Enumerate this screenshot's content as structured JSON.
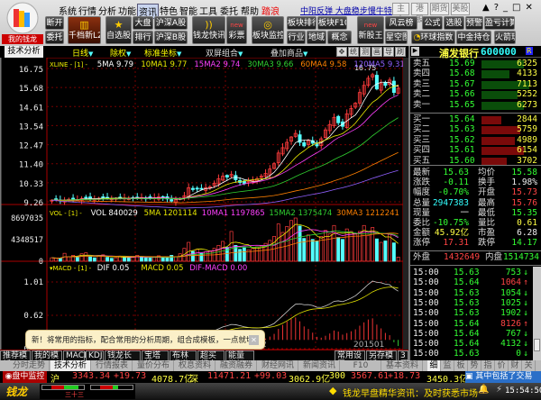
{
  "app": {
    "logo_label": "我的钱龙"
  },
  "menu": [
    "系统",
    "行情",
    "分析",
    "功能",
    "资讯",
    "特色",
    "智能",
    "工具",
    "委托",
    "帮助"
  ],
  "menu_promo": "踏浪",
  "headline": "中阳反弹 大盘稳步慢牛特征",
  "market_tabs": [
    "主力",
    "港股",
    "期货",
    "美股"
  ],
  "window_controls": [
    "▲",
    "?",
    "_",
    "□",
    "✕"
  ],
  "toolbar": {
    "disconnect": "断开",
    "trade": "委托",
    "l2": "千档新L2",
    "watchlist": "自选股",
    "dapan": "大盘",
    "rank": "排行",
    "hs_a": "沪深A股",
    "hs_b": "沪深B股",
    "news": "钱龙快讯",
    "lottery": "彩票",
    "lottery_badge": "new",
    "block_monitor": "板块监控",
    "block_rank": "板块排行",
    "block_f10": "板块F10",
    "industry": "行业",
    "region": "地域",
    "concept": "概念",
    "ipo": "新股王",
    "ipo_badge": "new",
    "fengyun": "风云榜",
    "starmap": "星空图",
    "formula": "公式",
    "pick": "选股",
    "alert": "预警",
    "pl": "盈亏计算",
    "global": "环球指数",
    "cicc": "中金持仓",
    "rocket": "火箭玩"
  },
  "analysis_bar": {
    "tab": "技术分析",
    "period": "日线",
    "rights": "除权",
    "coord": "标准坐标",
    "dual": "双屏组合",
    "overlay": "叠加商品",
    "tools": [
      "✥",
      "统",
      "测",
      "画",
      "导",
      "刷"
    ]
  },
  "stock": {
    "name": "浦发银行",
    "code": "600000",
    "badge": "R"
  },
  "price_panel": {
    "legend_name": "XLINE - [1] -",
    "legend": [
      {
        "t": "5MA 9.79",
        "c": "#ffffff"
      },
      {
        "t": "10MA1 9.77",
        "c": "#e8e800"
      },
      {
        "t": "15MA2 9.74",
        "c": "#ff40ff"
      },
      {
        "t": "30MA3 9.66",
        "c": "#30d030"
      },
      {
        "t": "60MA4 9.58",
        "c": "#ff8000"
      },
      {
        "t": "120MA5 9.31",
        "c": "#9060ff"
      }
    ],
    "axis": [
      "16.75",
      "15.68",
      "14.61",
      "13.54",
      "12.47",
      "11.40",
      "10.33",
      "9.26"
    ],
    "high_label": "16.75"
  },
  "volume_panel": {
    "legend_name": "VOL - [1] -",
    "legend": [
      {
        "t": "VOL 840029",
        "c": "#ffffff"
      },
      {
        "t": "5MA 1201114",
        "c": "#e8e800"
      },
      {
        "t": "10MA1 1197865",
        "c": "#ff40ff"
      },
      {
        "t": "15MA2 1375474",
        "c": "#30d030"
      },
      {
        "t": "30MA3 1212241",
        "c": "#ff8000"
      }
    ],
    "axis": [
      "8697035",
      "4348517",
      "0"
    ]
  },
  "macd_panel": {
    "legend_name": "▾MACD - [1] -",
    "legend": [
      {
        "t": "DIF 0.05",
        "c": "#ffffff"
      },
      {
        "t": "MACD 0.05",
        "c": "#e8e800"
      },
      {
        "t": "DIF-MACD 0.00",
        "c": "#ff40ff"
      }
    ],
    "axis": [
      "1.01",
      "0.62",
      "0.23"
    ],
    "date_labels": [
      "2",
      "201501"
    ]
  },
  "chart_data": {
    "type": "candlestick",
    "closes": [
      9.35,
      9.38,
      9.32,
      9.36,
      9.4,
      9.42,
      9.38,
      9.45,
      9.5,
      9.44,
      9.4,
      9.46,
      9.52,
      9.48,
      9.42,
      9.45,
      9.5,
      9.47,
      9.43,
      9.48,
      9.52,
      9.5,
      9.46,
      9.44,
      9.49,
      9.53,
      9.47,
      9.42,
      9.3,
      9.38,
      9.45,
      9.6,
      10.05,
      9.95,
      10.0,
      9.98,
      10.05,
      10.1,
      10.3,
      10.55,
      10.7,
      10.65,
      10.8,
      10.5,
      10.35,
      10.3,
      10.4,
      10.45,
      10.55,
      10.7,
      10.85,
      11.1,
      11.4,
      12.0,
      12.3,
      12.6,
      12.9,
      13.1,
      12.6,
      12.4,
      12.7,
      12.55,
      12.4,
      12.8,
      13.3,
      13.6,
      14.0,
      13.7,
      13.5,
      14.2,
      14.5,
      14.8,
      15.4,
      15.8,
      16.2,
      16.4,
      15.6,
      15.9,
      15.8,
      16.1,
      15.4,
      15.63
    ],
    "volumes": [
      700000,
      600000,
      650000,
      1600000,
      900000,
      1200000,
      800000,
      1500000,
      1700000,
      900000,
      700000,
      1100000,
      1300000,
      800000,
      600000,
      700000,
      1000000,
      900000,
      650000,
      800000,
      1200000,
      900000,
      700000,
      650000,
      800000,
      1100000,
      700000,
      650000,
      1200000,
      900000,
      1500000,
      2600000,
      3800000,
      2000000,
      2400000,
      1600000,
      1900000,
      2100000,
      2600000,
      3200000,
      4000000,
      2800000,
      6000000,
      3200000,
      2400000,
      2700000,
      2300000,
      2600000,
      2900000,
      3100000,
      3600000,
      4200000,
      5000000,
      7500000,
      5800000,
      7000000,
      8200000,
      8697035,
      7100000,
      4600000,
      5300000,
      4400000,
      4000000,
      5000000,
      6200000,
      5500000,
      7200000,
      4800000,
      4400000,
      6500000,
      6000000,
      5500000,
      6000000,
      7200000,
      5200000,
      6800000,
      4500000,
      3800000,
      4100000,
      5400000,
      3700000,
      840029
    ],
    "ylim": [
      9.26,
      16.75
    ]
  },
  "order_book": {
    "asks": [
      {
        "label": "卖五",
        "price": "15.69",
        "vol": "6325",
        "fill": 0.75
      },
      {
        "label": "卖四",
        "price": "15.68",
        "vol": "4133",
        "fill": 0.5
      },
      {
        "label": "卖三",
        "price": "15.67",
        "vol": "7113",
        "fill": 0.85
      },
      {
        "label": "卖二",
        "price": "15.66",
        "vol": "5252",
        "fill": 0.65
      },
      {
        "label": "卖一",
        "price": "15.65",
        "vol": "6273",
        "fill": 0.75
      }
    ],
    "bids": [
      {
        "label": "买一",
        "price": "15.64",
        "vol": "2844",
        "fill": 0.35
      },
      {
        "label": "买二",
        "price": "15.63",
        "vol": "5759",
        "fill": 0.7
      },
      {
        "label": "买三",
        "price": "15.62",
        "vol": "4989",
        "fill": 0.6
      },
      {
        "label": "买四",
        "price": "15.61",
        "vol": "6154",
        "fill": 0.75
      },
      {
        "label": "买五",
        "price": "15.60",
        "vol": "3702",
        "fill": 0.45
      }
    ]
  },
  "stats": [
    {
      "l1": "最新",
      "v1": "15.63",
      "c1": "g",
      "l2": "均价",
      "v2": "15.58",
      "c2": "g"
    },
    {
      "l1": "涨跌",
      "v1": "-0.11",
      "c1": "g",
      "l2": "换手",
      "v2": "1.98%",
      "c2": "w"
    },
    {
      "l1": "幅度",
      "v1": "-0.70%",
      "c1": "g",
      "l2": "开盘",
      "v2": "15.73",
      "c2": "r"
    },
    {
      "l1": "总量",
      "v1": "2947383",
      "c1": "c",
      "l2": "最高",
      "v2": "15.76",
      "c2": "r"
    },
    {
      "l1": "现量",
      "v1": "一",
      "c1": "w",
      "l2": "最低",
      "v2": "15.35",
      "c2": "g"
    },
    {
      "l1": "委比",
      "v1": "-10.75%",
      "c1": "g",
      "l2": "量比",
      "v2": "0.61",
      "c2": "y"
    },
    {
      "l1": "金额",
      "v1": "45.92亿",
      "c1": "y",
      "l2": "市盈",
      "v2": "6.28",
      "c2": "w"
    },
    {
      "l1": "涨停",
      "v1": "17.31",
      "c1": "r",
      "l2": "跌停",
      "v2": "14.17",
      "c2": "g"
    }
  ],
  "outer_inner": {
    "outer_label": "外盘",
    "outer": "1432649",
    "inner_label": "内盘",
    "inner": "1514734"
  },
  "ticks": [
    {
      "t": "15:00",
      "p": "15.63",
      "v": "753",
      "d": "↓",
      "c": "g"
    },
    {
      "t": "15:00",
      "p": "15.64",
      "v": "1064",
      "d": "↑",
      "c": "r"
    },
    {
      "t": "15:00",
      "p": "15.63",
      "v": "1054",
      "d": "↓",
      "c": "g"
    },
    {
      "t": "15:00",
      "p": "15.63",
      "v": "1025",
      "d": "↓",
      "c": "g"
    },
    {
      "t": "15:00",
      "p": "15.63",
      "v": "1902",
      "d": "↓",
      "c": "g"
    },
    {
      "t": "15:00",
      "p": "15.64",
      "v": "8126",
      "d": "↑",
      "c": "r"
    },
    {
      "t": "15:00",
      "p": "15.64",
      "v": "767",
      "d": "↓",
      "c": "g"
    },
    {
      "t": "15:00",
      "p": "15.64",
      "v": "4132",
      "d": "↓",
      "c": "g"
    },
    {
      "t": "15:00",
      "p": "15.63",
      "v": "0",
      "d": "↓",
      "c": "g"
    }
  ],
  "tooltip": {
    "text": "新！将常用的指标，配合常用的分析周期，组合成模板，一点就切换。",
    "close": "✕"
  },
  "templates": [
    "推荐模板",
    "我的模板",
    "MACD",
    "KDJ",
    "钱龙长短线",
    "宝塔线",
    "布林通道",
    "超买超卖",
    "能量指标"
  ],
  "template_actions": [
    "常用设置",
    "另存模板",
    "3图"
  ],
  "tabs": [
    "分时走势",
    "技术分析",
    "行情报表",
    "量价分布",
    "权息资料",
    "融资融券",
    "财经网讯",
    "新闻资讯",
    "F10",
    "基本资料"
  ],
  "side_tabs": [
    "细",
    "监",
    "板",
    "势",
    "指",
    "价",
    "财",
    "关"
  ],
  "indices": {
    "monitor": "盘中监控",
    "sh_label": "沪",
    "sh": "3343.34",
    "sh_chg": "+19.73",
    "sh_amt": "4078.7亿",
    "sz_label": "深",
    "sz": "11471.21",
    "sz_chg": "+99.03",
    "sz_amt": "3062.9亿",
    "hs300_label": "300",
    "hs300": "3567.61",
    "hs300_chg": "+18.73",
    "hs300_amt": "3450.3亿",
    "ticker": "其中包括了交易"
  },
  "bottom": {
    "logo": "钱龙",
    "indicator": "三十三",
    "news": "钱龙早盘精华资讯：及时获悉市场",
    "time": "15:54:50"
  }
}
